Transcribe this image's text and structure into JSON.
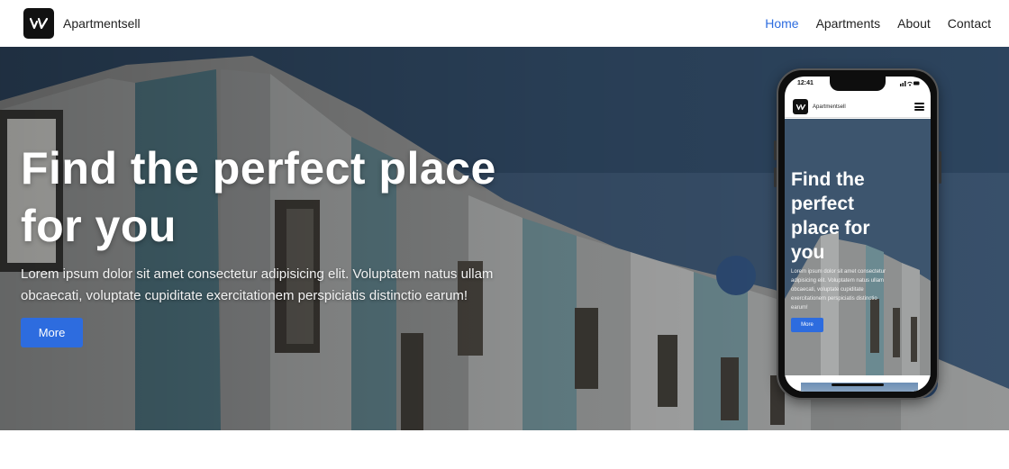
{
  "navbar": {
    "brand": "Apartmentsell",
    "links": [
      {
        "label": "Home",
        "active": true
      },
      {
        "label": "Apartments",
        "active": false
      },
      {
        "label": "About",
        "active": false
      },
      {
        "label": "Contact",
        "active": false
      }
    ]
  },
  "hero": {
    "title_line1": "Find the perfect place",
    "title_line2": "for you",
    "text_line1": "Lorem ipsum dolor sit amet consectetur adipisicing elit. Voluptatem natus ullam",
    "text_line2": "obcaecati, voluptate cupiditate exercitationem perspiciatis distinctio earum!",
    "button": "More"
  },
  "phone": {
    "time": "12:41",
    "brand": "Apartmentsell",
    "title_lines": [
      "Find the",
      "perfect",
      "place for",
      "you"
    ],
    "text_lines": [
      "Lorem ipsum dolor sit amet consectetur",
      "adipisicing elit. Voluptatem natus ullam",
      "obcaecati, voluptate cupiditate",
      "exercitationem perspiciatis distinctio",
      "earum!"
    ],
    "button": "More"
  },
  "colors": {
    "accent": "#2d6cdf",
    "logo_bg": "#111111"
  },
  "icons": {
    "logo": "apartmentsell-logo-icon",
    "menu": "hamburger-menu-icon"
  }
}
